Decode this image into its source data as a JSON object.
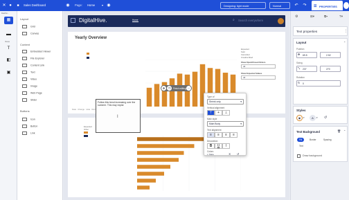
{
  "topbar": {
    "title": "Sales Dashboard",
    "page_label": "Page:",
    "page_value": "Home",
    "theme": "Designing: light mode",
    "mode": "Normal",
    "properties_tab": "PROPERTIES"
  },
  "rail": {
    "dashboard_label": "Dashbo...",
    "views_label": "Views",
    "data_label": "Data"
  },
  "components": {
    "layout_title": "Layout",
    "layout_items": [
      "Grid",
      "Canvas"
    ],
    "content_title": "Content",
    "content_items": [
      "Embedded Viewer",
      "File Explorer",
      "Content Link",
      "Text",
      "Video",
      "Image",
      "Web Page",
      "Slider"
    ],
    "buttons_title": "Buttons",
    "button_items": [
      "Icon",
      "Button",
      "Link"
    ]
  },
  "canvas": {
    "brand": "DigitalHive.",
    "nav_item": "Home",
    "search_placeholder": "Search everywhere",
    "overview_title": "Yearly Overview",
    "legend_right": [
      "Expected",
      "Sold",
      "Cancelled",
      "Unsubscribed"
    ],
    "show_open_label": "Show Open/Closed Orders",
    "show_open_value": "All",
    "show_expected_label": "Show Expected Values",
    "show_expected_value": "All",
    "textbox_text": "Follow this trend increasing over the summer. This may explai",
    "floating_label": "Finish editing",
    "popup": {
      "type_label": "Type of",
      "type_value": "Shrink only",
      "vertical_label": "Vertical alignment",
      "font_label": "Main style",
      "font_value": "Main Body",
      "text_align_label": "Text alignment",
      "decoration_label": "Decoration",
      "colors_label": "Colors",
      "color_value": "None"
    },
    "card1_footer": [
      "Data",
      "Change",
      "Hide",
      "Refresh"
    ],
    "card1_footer_right": [
      "Data Profile",
      "Edit",
      "Show",
      "Unpin"
    ],
    "card2_legend": [
      "Expected",
      "Other"
    ]
  },
  "props": {
    "title": "Text properties",
    "layout_title": "Layout",
    "position_label": "Position",
    "pos_x": "69.5",
    "pos_y": "2.52",
    "size_label": "Sizing",
    "width": "237",
    "height": "270",
    "rotation_label": "Rotation",
    "rotation": "0",
    "styles_title": "Styles",
    "text_bg_title": "Text Background",
    "chips": [
      "Fill",
      "Border",
      "Spacing"
    ],
    "chip_sub": "Text",
    "draw_bg_label": "Draw background"
  },
  "colors": {
    "topbar": "#1f4fd8",
    "bar": "#d98a2b",
    "bar_dark": "#b8701c",
    "navy": "#1b2b5a",
    "accent": "#1f4fd8"
  },
  "chart_data": [
    {
      "type": "bar",
      "title": "",
      "categories": [
        "",
        "",
        "",
        "",
        "",
        "",
        "",
        "",
        "",
        "",
        "",
        ""
      ],
      "values": [
        40,
        48,
        52,
        60,
        70,
        68,
        74,
        90,
        82,
        80,
        72,
        68
      ],
      "ylim": [
        0,
        100
      ],
      "grid": true
    },
    {
      "type": "bar",
      "title": "",
      "categories": [
        "",
        "",
        "",
        "",
        "",
        "",
        "",
        ""
      ],
      "values": [
        90,
        55,
        45,
        40,
        32,
        26,
        18,
        12
      ],
      "xlim": [
        0,
        100
      ],
      "grid": true
    }
  ]
}
